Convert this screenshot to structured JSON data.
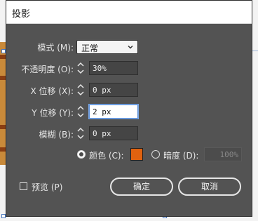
{
  "dialog": {
    "title": "投影",
    "mode": {
      "label": "模式 (M):",
      "value": "正常"
    },
    "opacity": {
      "label": "不透明度 (O):",
      "value": "30%"
    },
    "x_offset": {
      "label": "X 位移 (X):",
      "value": "0 px"
    },
    "y_offset": {
      "label": "Y 位移 (Y):",
      "value": "2 px"
    },
    "blur": {
      "label": "模糊 (B):",
      "value": "0 px"
    },
    "color_option": {
      "label": "颜色 (C):",
      "selected": true,
      "swatch": "#e0620f"
    },
    "darkness_option": {
      "label": "暗度 (D):",
      "selected": false,
      "value": "100%"
    },
    "preview": {
      "label": "预览 (P)",
      "checked": false
    },
    "ok_label": "确定",
    "cancel_label": "取消"
  },
  "icons": [
    "chevron-down-icon",
    "spinner-up-down-icon"
  ],
  "colors": {
    "dialog_bg": "#535353",
    "accent": "#e0620f",
    "focus": "#5a8ed6"
  }
}
